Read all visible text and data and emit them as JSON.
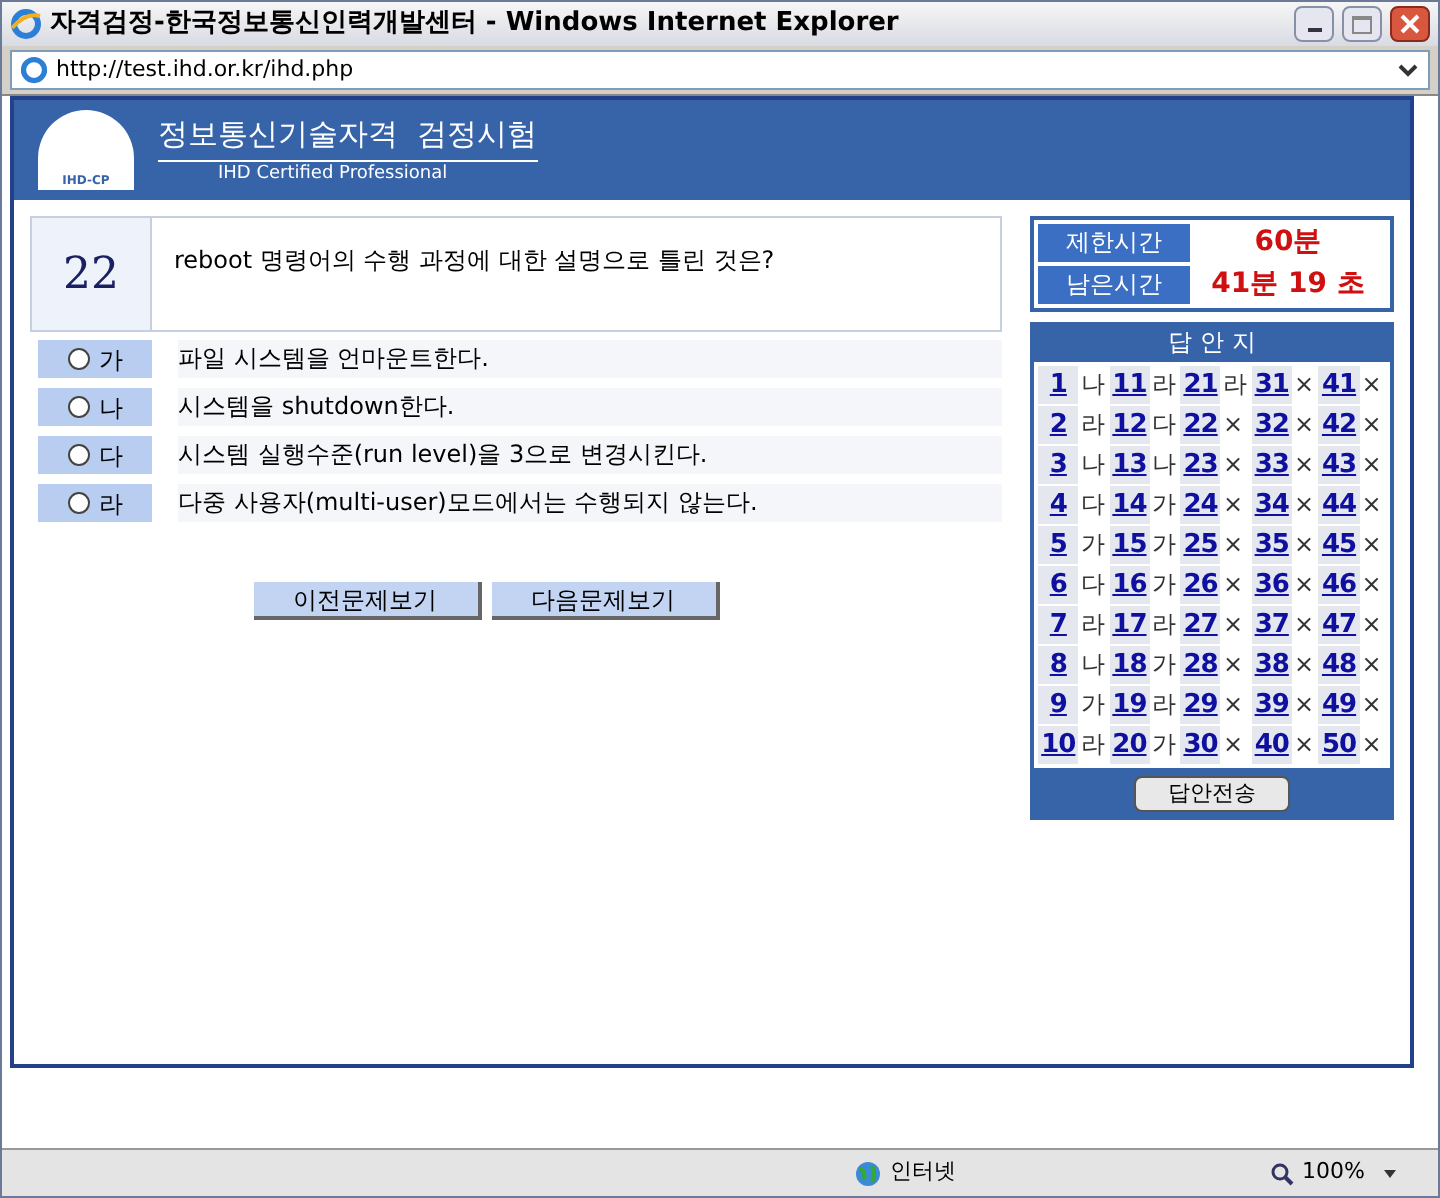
{
  "window": {
    "title": "자격검정-한국정보통신인력개발센터 - Windows Internet Explorer"
  },
  "address_bar": {
    "url": "http://test.ihd.or.kr/ihd.php"
  },
  "header": {
    "logo_text": "IHD-CP",
    "title": "정보통신기술자격  검정시험",
    "subtitle": "IHD Certified Professional"
  },
  "question": {
    "number": "22",
    "text": "reboot 명령어의 수행 과정에 대한 설명으로 틀린 것은?"
  },
  "options": [
    {
      "label": "가",
      "text": "파일 시스템을 언마운트한다.",
      "selected": false
    },
    {
      "label": "나",
      "text": "시스템을 shutdown한다.",
      "selected": false
    },
    {
      "label": "다",
      "text": "시스템 실행수준(run level)을 3으로 변경시킨다.",
      "selected": false
    },
    {
      "label": "라",
      "text": "다중 사용자(multi-user)모드에서는 수행되지 않는다.",
      "selected": false
    }
  ],
  "nav_buttons": [
    "이전문제보기",
    "다음문제보기"
  ],
  "timer": [
    {
      "label": "제한시간",
      "value": "60분"
    },
    {
      "label": "남은시간",
      "value": "41분 19 초"
    }
  ],
  "answer_sheet": {
    "title": "답 안 지",
    "answers": [
      {
        "number": "1",
        "answer": "나"
      },
      {
        "number": "2",
        "answer": "라"
      },
      {
        "number": "3",
        "answer": "나"
      },
      {
        "number": "4",
        "answer": "다"
      },
      {
        "number": "5",
        "answer": "가"
      },
      {
        "number": "6",
        "answer": "다"
      },
      {
        "number": "7",
        "answer": "라"
      },
      {
        "number": "8",
        "answer": "나"
      },
      {
        "number": "9",
        "answer": "가"
      },
      {
        "number": "10",
        "answer": "라"
      },
      {
        "number": "11",
        "answer": "라"
      },
      {
        "number": "12",
        "answer": "다"
      },
      {
        "number": "13",
        "answer": "나"
      },
      {
        "number": "14",
        "answer": "가"
      },
      {
        "number": "15",
        "answer": "가"
      },
      {
        "number": "16",
        "answer": "가"
      },
      {
        "number": "17",
        "answer": "라"
      },
      {
        "number": "18",
        "answer": "가"
      },
      {
        "number": "19",
        "answer": "라"
      },
      {
        "number": "20",
        "answer": "가"
      },
      {
        "number": "21",
        "answer": "라"
      },
      {
        "number": "22",
        "answer": "×"
      },
      {
        "number": "23",
        "answer": "×"
      },
      {
        "number": "24",
        "answer": "×"
      },
      {
        "number": "25",
        "answer": "×"
      },
      {
        "number": "26",
        "answer": "×"
      },
      {
        "number": "27",
        "answer": "×"
      },
      {
        "number": "28",
        "answer": "×"
      },
      {
        "number": "29",
        "answer": "×"
      },
      {
        "number": "30",
        "answer": "×"
      },
      {
        "number": "31",
        "answer": "×"
      },
      {
        "number": "32",
        "answer": "×"
      },
      {
        "number": "33",
        "answer": "×"
      },
      {
        "number": "34",
        "answer": "×"
      },
      {
        "number": "35",
        "answer": "×"
      },
      {
        "number": "36",
        "answer": "×"
      },
      {
        "number": "37",
        "answer": "×"
      },
      {
        "number": "38",
        "answer": "×"
      },
      {
        "number": "39",
        "answer": "×"
      },
      {
        "number": "40",
        "answer": "×"
      },
      {
        "number": "41",
        "answer": "×"
      },
      {
        "number": "42",
        "answer": "×"
      },
      {
        "number": "43",
        "answer": "×"
      },
      {
        "number": "44",
        "answer": "×"
      },
      {
        "number": "45",
        "answer": "×"
      },
      {
        "number": "46",
        "answer": "×"
      },
      {
        "number": "47",
        "answer": "×"
      },
      {
        "number": "48",
        "answer": "×"
      },
      {
        "number": "49",
        "answer": "×"
      },
      {
        "number": "50",
        "answer": "×"
      }
    ],
    "submit_button": "답안전송"
  },
  "status_bar": {
    "zone": "인터넷",
    "zoom": "100%"
  }
}
